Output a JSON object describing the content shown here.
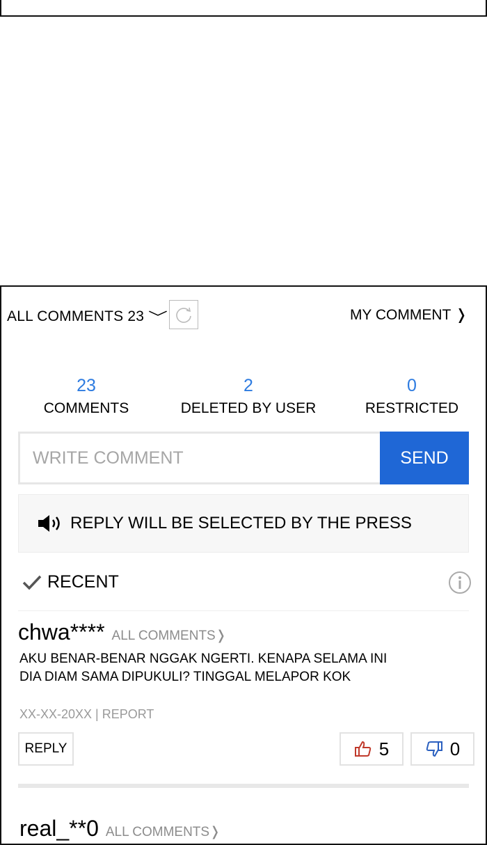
{
  "header": {
    "all_comments_label": "ALL COMMENTS 23",
    "my_comment_label": "MY COMMENT",
    "chev_down": "﹀",
    "chev_right": "❭"
  },
  "stats": [
    {
      "num": "23",
      "label": "COMMENTS"
    },
    {
      "num": "2",
      "label": "DELETED BY USER"
    },
    {
      "num": "0",
      "label": "RESTRICTED"
    }
  ],
  "write": {
    "placeholder": "WRITE COMMENT",
    "send_label": "SEND"
  },
  "notice": {
    "text": "REPLY WILL BE SELECTED BY THE PRESS"
  },
  "recent": {
    "label": "RECENT"
  },
  "comments": [
    {
      "user": "chwa****",
      "all_comments": "ALL COMMENTS❭",
      "text_line1": "AKU BENAR-BENAR NGGAK NGERTI. KENAPA SELAMA INI",
      "text_line2": "DIA DIAM SAMA DIPUKULI? TINGGAL MELAPOR KOK",
      "meta": "XX-XX-20XX | REPORT",
      "reply_label": "REPLY",
      "likes": "5",
      "dislikes": "0"
    },
    {
      "user": "real_**0",
      "all_comments": "ALL COMMENTS❭"
    }
  ],
  "colors": {
    "accent": "#2d7be0",
    "send_bg": "#1f67d6",
    "like": "#c0392b",
    "dislike": "#2a5fbf"
  }
}
